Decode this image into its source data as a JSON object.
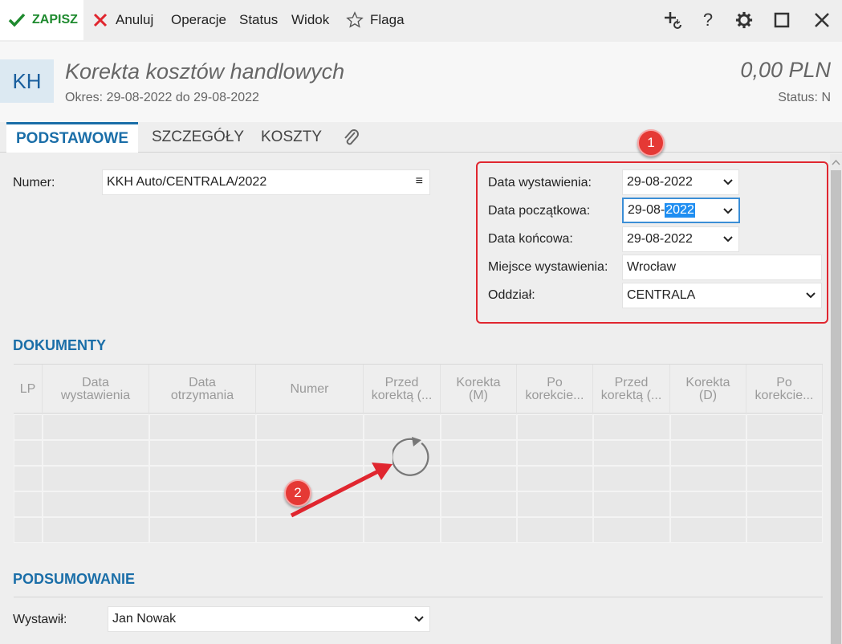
{
  "toolbar": {
    "save_label": "ZAPISZ",
    "cancel_label": "Anuluj",
    "operations_label": "Operacje",
    "status_label": "Status",
    "view_label": "Widok",
    "flag_label": "Flaga",
    "help_label": "?"
  },
  "header": {
    "badge": "KH",
    "title": "Korekta kosztów handlowych",
    "period": "Okres: 29-08-2022 do 29-08-2022",
    "amount": "0,00 PLN",
    "status": "Status: N"
  },
  "tabs": [
    {
      "label": "PODSTAWOWE"
    },
    {
      "label": "SZCZEGÓŁY"
    },
    {
      "label": "KOSZTY"
    }
  ],
  "form": {
    "number_label": "Numer:",
    "number_value": "KKH Auto/CENTRALA/2022",
    "issue_date_label": "Data wystawienia:",
    "issue_date_value": "29-08-2022",
    "start_date_label": "Data początkowa:",
    "start_date_prefix": "29-08-",
    "start_date_selected": "2022",
    "end_date_label": "Data końcowa:",
    "end_date_value": "29-08-2022",
    "place_label": "Miejsce wystawienia:",
    "place_value": "Wrocław",
    "branch_label": "Oddział:",
    "branch_value": "CENTRALA"
  },
  "annotations": {
    "badge1": "1",
    "badge2": "2"
  },
  "documents": {
    "title": "DOKUMENTY",
    "columns": [
      {
        "l1": "LP",
        "l2": ""
      },
      {
        "l1": "Data",
        "l2": "wystawienia"
      },
      {
        "l1": "Data",
        "l2": "otrzymania"
      },
      {
        "l1": "Numer",
        "l2": ""
      },
      {
        "l1": "Przed",
        "l2": "korektą (..."
      },
      {
        "l1": "Korekta",
        "l2": "(M)"
      },
      {
        "l1": "Po",
        "l2": "korekcie..."
      },
      {
        "l1": "Przed",
        "l2": "korektą (..."
      },
      {
        "l1": "Korekta",
        "l2": "(D)"
      },
      {
        "l1": "Po",
        "l2": "korekcie..."
      }
    ]
  },
  "summary": {
    "title": "PODSUMOWANIE",
    "issued_by_label": "Wystawił:",
    "issued_by_value": "Jan Nowak"
  },
  "colors": {
    "accent": "#1a6ea8",
    "save": "#1e8a2e",
    "cancel": "#e0262f",
    "annotation": "#e53935"
  }
}
